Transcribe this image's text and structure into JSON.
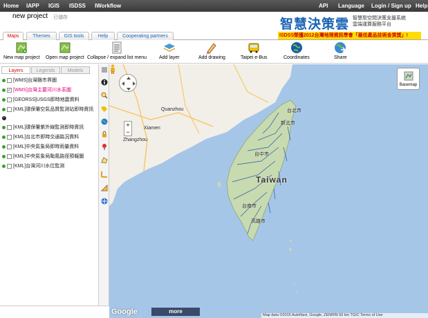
{
  "topbar": {
    "left_items": [
      "Home",
      "IAPP",
      "IGIS",
      "ISDSS",
      "IWorkflow"
    ],
    "right_items": [
      "API",
      "Language",
      "Login / Sign up",
      "Help"
    ]
  },
  "header": {
    "project_title": "new project",
    "saved_status": "已儲存",
    "brand_main": "智慧決策雲",
    "brand_sub1": "智慧型空間決策支援系統",
    "brand_sub2": "雲端運算服務平台"
  },
  "tabs": [
    "Maps",
    "Themes",
    "GIS tools",
    "Help",
    "Cooperating partners"
  ],
  "announcement": "ISDSS榮獲2012台灣地理資訊學會「最佳產品技術金質獎」!",
  "toolbar": [
    {
      "label": "New map project",
      "icon": "new-map-icon"
    },
    {
      "label": "Open map project",
      "icon": "open-map-icon"
    },
    {
      "label": "Collapse / expand list menu",
      "icon": "list-menu-icon"
    },
    {
      "label": "Add layer",
      "icon": "add-layer-icon"
    },
    {
      "label": "Add drawing",
      "icon": "drawing-icon"
    },
    {
      "label": "Taipei e-Bus",
      "icon": "bus-icon"
    },
    {
      "label": "Coordinates",
      "icon": "globe-icon"
    },
    {
      "label": "Share",
      "icon": "share-icon"
    }
  ],
  "panel_tabs": [
    "Layers",
    "Legends",
    "Models"
  ],
  "layers": [
    {
      "label": "[WMS]台灣縣市界圖",
      "checked": false,
      "highlight": false
    },
    {
      "label": "[WMS]台灣主要河川水系圖",
      "checked": true,
      "highlight": true
    },
    {
      "label": "[GEORSS]USGS即時地震資料",
      "checked": false,
      "highlight": false
    },
    {
      "label": "[KML]環保署空氣品質監測站即時資訊",
      "checked": false,
      "highlight": false
    },
    {
      "label": "[KML]環保署紫外線監測即時資訊",
      "checked": false,
      "highlight": false
    },
    {
      "label": "[KML]台北市即時交通路況資料",
      "checked": false,
      "highlight": false
    },
    {
      "label": "[KML]中央氣象局即時雨量資料",
      "checked": false,
      "highlight": false
    },
    {
      "label": "[KML]中央氣象局颱風路徑預報圖",
      "checked": false,
      "highlight": false
    },
    {
      "label": "[KML]台灣河川水位監測",
      "checked": false,
      "highlight": false
    }
  ],
  "map": {
    "labels": [
      {
        "text": "Quanzhou",
        "kind": "city"
      },
      {
        "text": "Xiamen",
        "kind": "city"
      },
      {
        "text": "Zhangzhou",
        "kind": "city"
      },
      {
        "text": "Taiwan",
        "kind": "country"
      },
      {
        "text": "台北市",
        "kind": "city"
      },
      {
        "text": "新北市",
        "kind": "city"
      },
      {
        "text": "台中市",
        "kind": "city"
      },
      {
        "text": "台南市",
        "kind": "city"
      },
      {
        "text": "高雄市",
        "kind": "city"
      }
    ],
    "basemap_label": "Basemap",
    "more_label": "more",
    "google_logo": "Google",
    "attribution": "Map data ©2015 AutoNavi, Google, ZENRIN   50 km          TGIC   Terms of Use",
    "zoom_in": "+",
    "zoom_out": "−"
  },
  "colors": {
    "sea": "#a6c6e8",
    "land": "#f2efe9",
    "taiwan_land": "#c8dab0",
    "river": "#2a5aa8",
    "accent_red": "#e00000",
    "brand_blue": "#1a64b4",
    "announce_bg": "#ffdd00"
  }
}
